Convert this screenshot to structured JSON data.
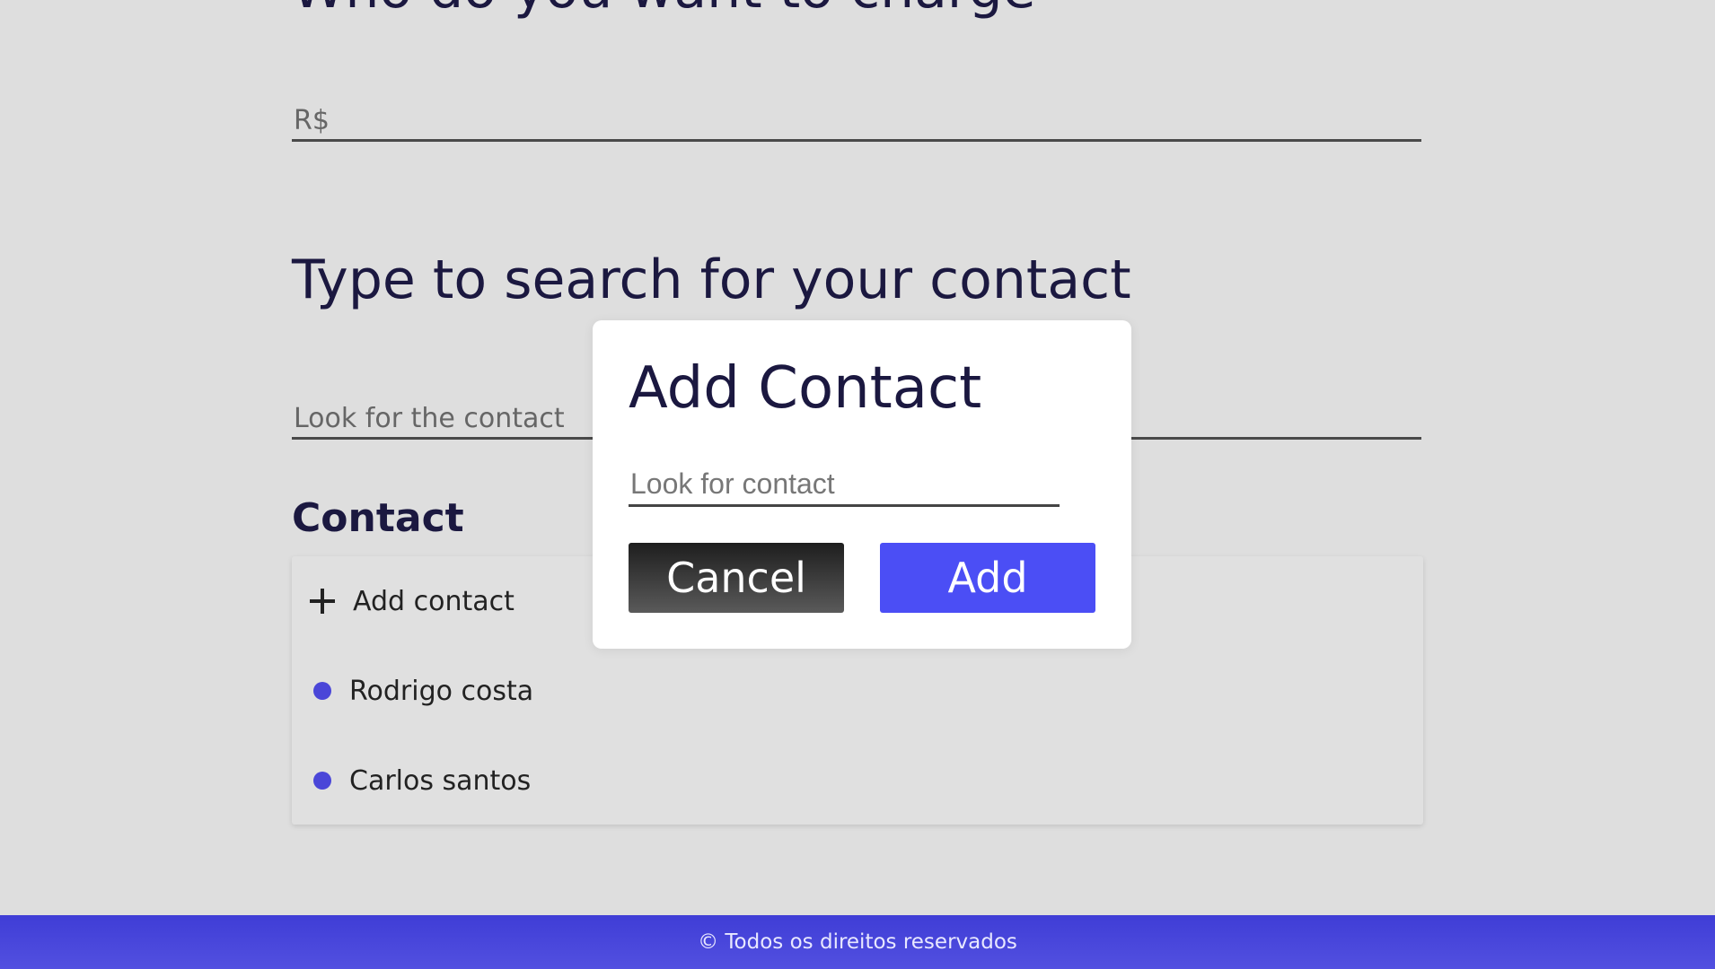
{
  "main": {
    "cut_title": "Who do you want to charge",
    "amount_placeholder": "R$",
    "search_title": "Type to search for your contact",
    "search_placeholder": "Look for the contact",
    "contact_heading": "Contact",
    "add_contact_label": "Add contact",
    "contacts": [
      "Rodrigo costa",
      "Carlos santos"
    ]
  },
  "modal": {
    "title": "Add Contact",
    "input_placeholder": "Look for contact",
    "cancel_label": "Cancel",
    "add_label": "Add"
  },
  "footer": {
    "text": "© Todos os direitos reservados"
  },
  "colors": {
    "accent": "#4b4ef5",
    "background": "#dedede",
    "heading": "#1b1840",
    "contact_dot": "#4a46d8"
  },
  "icons": {
    "add_contact": "plus-icon",
    "contact_item": "dot-icon"
  }
}
